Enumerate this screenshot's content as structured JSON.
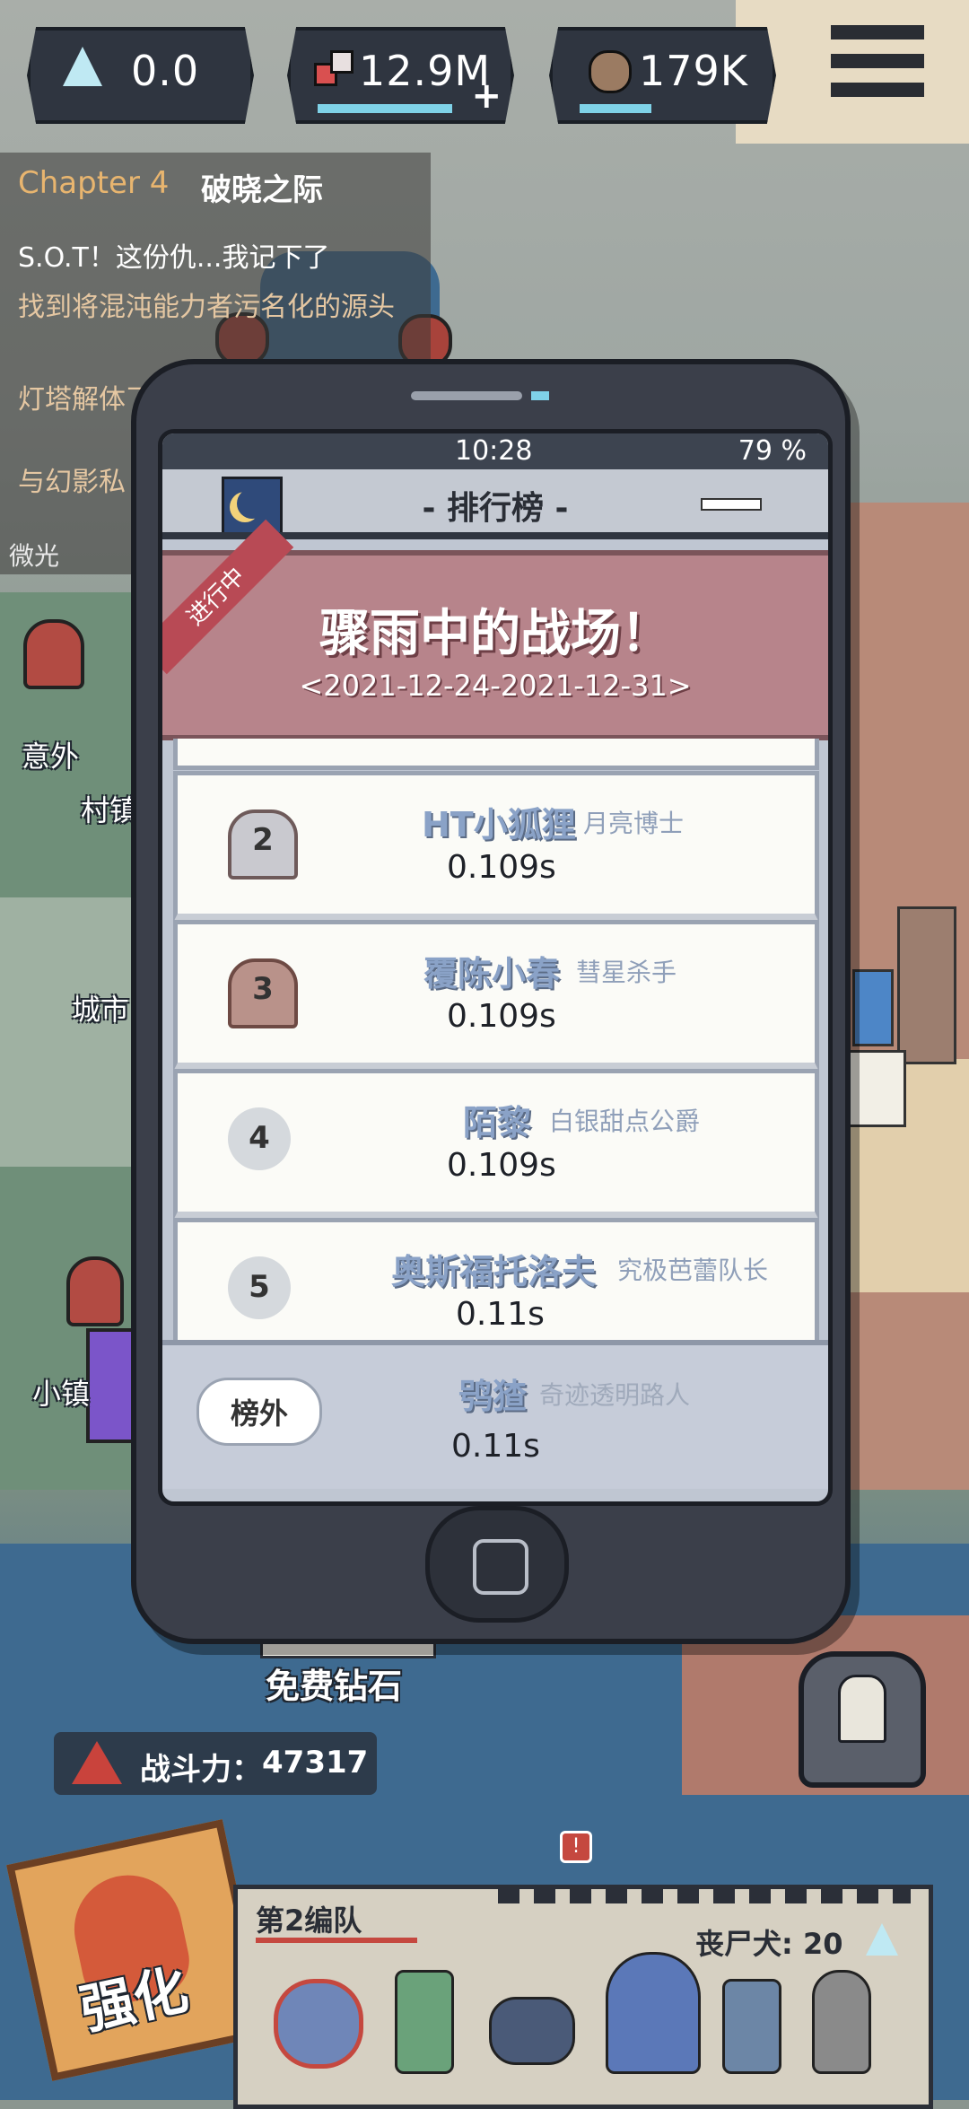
{
  "resources": [
    {
      "icon": "triangle-gem-icon",
      "value": "0.0"
    },
    {
      "icon": "red-cubes-icon",
      "value": "12.9M"
    },
    {
      "icon": "orb-icon",
      "value": "179K"
    }
  ],
  "chapter": {
    "label": "Chapter 4",
    "title": "破晓之际",
    "quests": [
      "S.O.T！这份仇...我记下了",
      "找到将混沌能力者污名化的源头",
      "灯塔解体了",
      "与幻影私",
      "微光"
    ]
  },
  "map_labels": [
    "意外",
    "村镇",
    "城市",
    "小镇",
    "免费钻石"
  ],
  "power": {
    "label": "战斗力：",
    "value": "47317"
  },
  "phone": {
    "time": "10:28",
    "battery": "79 %",
    "title": "- 排行榜 -",
    "banner_tag": "进行中",
    "event_title": "骤雨中的战场！",
    "event_dates": "<2021-12-24-2021-12-31>",
    "rows": [
      {
        "rank": "2",
        "name": "HT小狐狸",
        "title": "月亮博士",
        "time": "0.109s"
      },
      {
        "rank": "3",
        "name": "覆陈小春",
        "title": "彗星杀手",
        "time": "0.109s"
      },
      {
        "rank": "4",
        "name": "陌黎",
        "title": "白银甜点公爵",
        "time": "0.109s"
      },
      {
        "rank": "5",
        "name": "奥斯福托洛夫",
        "title": "究极芭蕾队长",
        "time": "0.11s"
      }
    ],
    "self": {
      "rank": "榜外",
      "name": "鸮猹",
      "title": "奇迹透明路人",
      "time": "0.11s"
    }
  },
  "team": {
    "name": "第2编队",
    "dog_label": "丧尸犬: 20"
  },
  "boost_label": "强化",
  "colors": {
    "accent": "#e2a45c",
    "phone_body": "#3b3f4a",
    "banner": "#b7848b"
  }
}
